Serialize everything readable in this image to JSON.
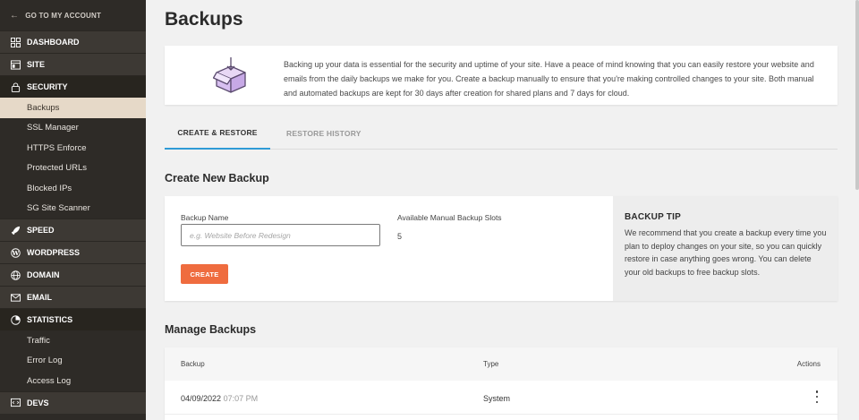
{
  "sidebar": {
    "back_label": "GO TO MY ACCOUNT",
    "sections": [
      {
        "label": "DASHBOARD",
        "icon": "dashboard-icon"
      },
      {
        "label": "SITE",
        "icon": "site-icon"
      },
      {
        "label": "SECURITY",
        "icon": "lock-icon",
        "items": [
          "Backups",
          "SSL Manager",
          "HTTPS Enforce",
          "Protected URLs",
          "Blocked IPs",
          "SG Site Scanner"
        ],
        "active_item": "Backups"
      },
      {
        "label": "SPEED",
        "icon": "rocket-icon"
      },
      {
        "label": "WORDPRESS",
        "icon": "wordpress-icon"
      },
      {
        "label": "DOMAIN",
        "icon": "globe-icon"
      },
      {
        "label": "EMAIL",
        "icon": "envelope-icon"
      },
      {
        "label": "STATISTICS",
        "icon": "chart-icon",
        "items": [
          "Traffic",
          "Error Log",
          "Access Log"
        ]
      },
      {
        "label": "DEVS",
        "icon": "code-icon"
      }
    ]
  },
  "page": {
    "title": "Backups",
    "intro_text": "Backing up your data is essential for the security and uptime of your site. Have a peace of mind knowing that you can easily restore your website and emails from the daily backups we make for you. Create a backup manually to ensure that you're making controlled changes to your site. Both manual and automated backups are kept for 30 days after creation for shared plans and 7 days for cloud."
  },
  "tabs": [
    {
      "label": "CREATE & RESTORE",
      "active": true
    },
    {
      "label": "RESTORE HISTORY",
      "active": false
    }
  ],
  "create": {
    "section_title": "Create New Backup",
    "name_label": "Backup Name",
    "name_placeholder": "e.g. Website Before Redesign",
    "slots_label": "Available Manual Backup Slots",
    "slots_value": "5",
    "button_label": "CREATE",
    "tip_title": "BACKUP TIP",
    "tip_text": "We recommend that you create a backup every time you plan to deploy changes on your site, so you can quickly restore in case anything goes wrong. You can delete your old backups to free backup slots."
  },
  "manage": {
    "section_title": "Manage Backups",
    "columns": {
      "backup": "Backup",
      "type": "Type",
      "actions": "Actions"
    },
    "rows": [
      {
        "date": "04/09/2022",
        "time": "07:07 PM",
        "type": "System"
      }
    ]
  },
  "colors": {
    "accent_button": "#ef6c3f",
    "tab_active": "#2f9bd6",
    "sidebar_bg": "#2e2b27",
    "sidebar_active": "#e6d9c8"
  }
}
